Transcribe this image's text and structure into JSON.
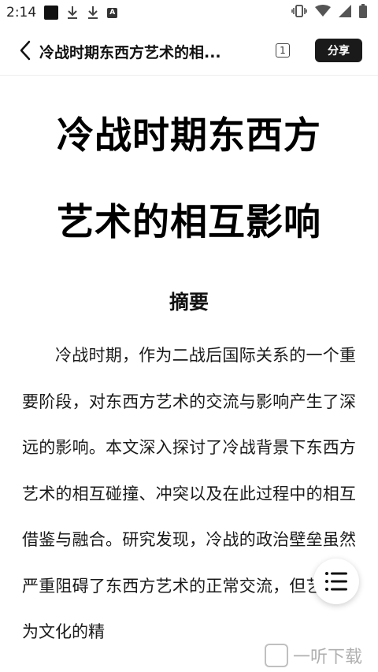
{
  "status_bar": {
    "time": "2:14"
  },
  "header": {
    "title": "冷战时期东西方艺术的相...",
    "page_badge": "1",
    "share_label": "分享"
  },
  "article": {
    "title_line1": "冷战时期东西方",
    "title_line2": "艺术的相互影响",
    "abstract_heading": "摘要",
    "abstract_text": "冷战时期，作为二战后国际关系的一个重要阶段，对东西方艺术的交流与影响产生了深远的影响。本文深入探讨了冷战背景下东西方艺术的相互碰撞、冲突以及在此过程中的相互借鉴与融合。研究发现，冷战的政治壁垒虽然严重阻碍了东西方艺术的正常交流，但艺术作为文化的精"
  },
  "watermark": {
    "text": "一听下载"
  }
}
